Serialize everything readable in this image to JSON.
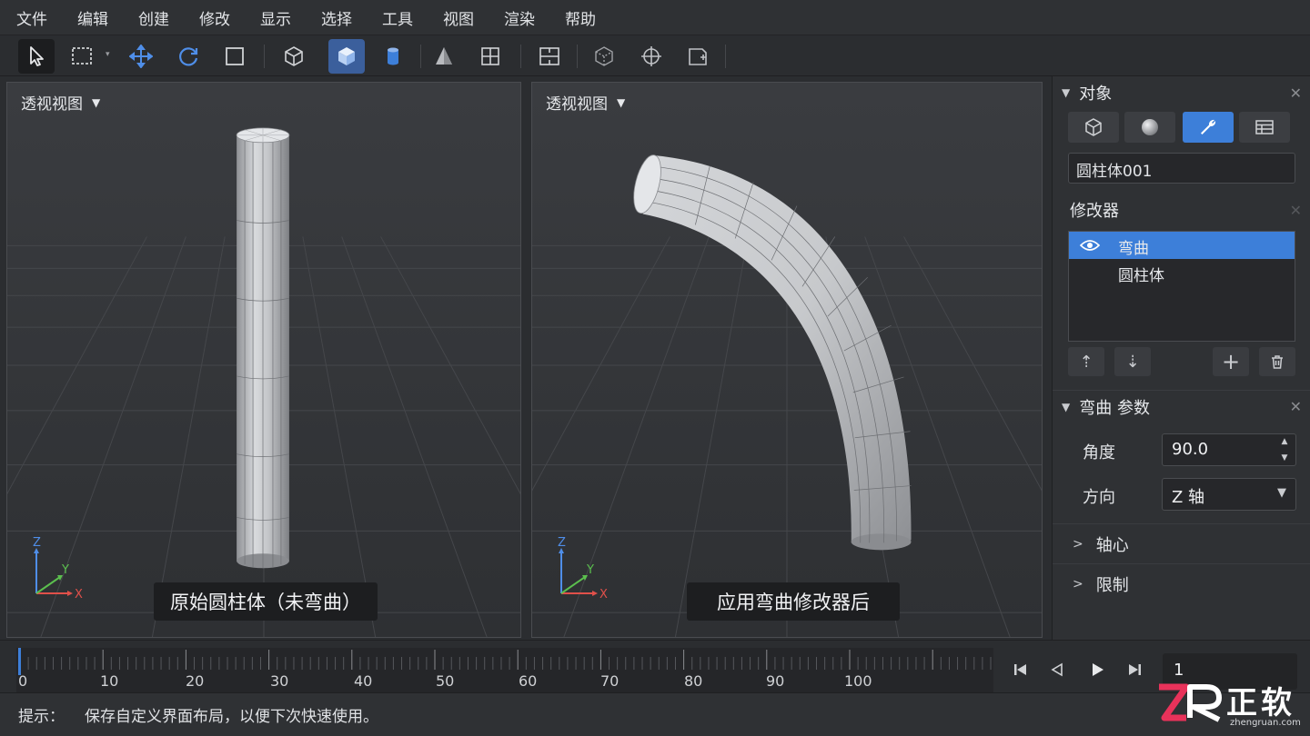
{
  "menu": [
    "文件",
    "编辑",
    "创建",
    "修改",
    "显示",
    "选择",
    "工具",
    "视图",
    "渲染",
    "帮助"
  ],
  "toolbar": {
    "icons": [
      "select-arrow-icon",
      "rect-select-icon",
      "move-icon",
      "rotate-icon",
      "scale-square-icon",
      "cube-wire-icon",
      "cube-solid-icon",
      "cylinder-icon",
      "cone-icon",
      "grid-quad-icon",
      "viewport-layout-icon",
      "box-wire-icon",
      "crosshair-icon",
      "snap-corner-icon"
    ],
    "accent": "#3d7fd9"
  },
  "viewports": {
    "left": {
      "title": "透视视图",
      "caption": "原始圆柱体（未弯曲）"
    },
    "right": {
      "title": "透视视图",
      "caption": "应用弯曲修改器后"
    },
    "axes": {
      "x": "X",
      "y": "Y",
      "z": "Z"
    }
  },
  "panel": {
    "object": {
      "header": "对象",
      "tabs": [
        "cube-icon",
        "sphere-icon",
        "wrench-icon",
        "table-icon"
      ],
      "active_tab": 2,
      "name": "圆柱体001"
    },
    "modifiers": {
      "header": "修改器",
      "items": [
        {
          "label": "弯曲",
          "selected": true
        },
        {
          "label": "圆柱体",
          "selected": false
        }
      ]
    },
    "params": {
      "header": "弯曲 参数",
      "angle_label": "角度",
      "angle_value": "90.0",
      "direction_label": "方向",
      "direction_value": "Z 轴",
      "sections": [
        "轴心",
        "限制"
      ]
    }
  },
  "timeline": {
    "ticks": [
      "0",
      "10",
      "20",
      "30",
      "40",
      "50",
      "60",
      "70",
      "80",
      "90",
      "100"
    ],
    "current_frame": "1"
  },
  "status": {
    "prefix": "提示：",
    "message": "保存自定义界面布局，以便下次快速使用。"
  },
  "watermark": {
    "cn": "正软",
    "en": "zhengruan.com"
  }
}
